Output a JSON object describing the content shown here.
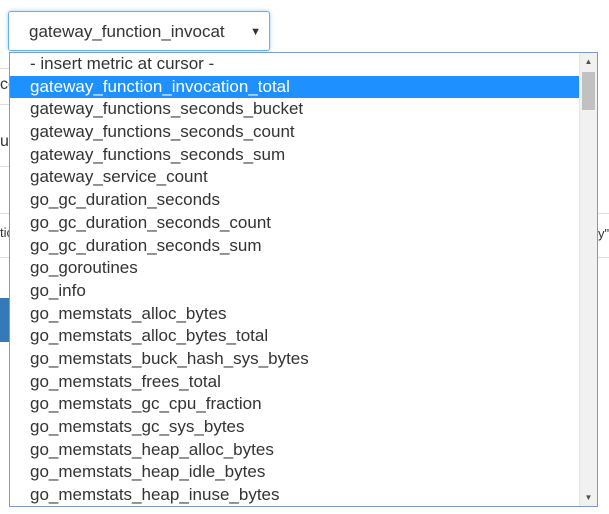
{
  "select": {
    "value": "gateway_function_invocat",
    "caret": "▼"
  },
  "options": [
    "- insert metric at cursor -",
    "gateway_function_invocation_total",
    "gateway_functions_seconds_bucket",
    "gateway_functions_seconds_count",
    "gateway_functions_seconds_sum",
    "gateway_service_count",
    "go_gc_duration_seconds",
    "go_gc_duration_seconds_count",
    "go_gc_duration_seconds_sum",
    "go_goroutines",
    "go_info",
    "go_memstats_alloc_bytes",
    "go_memstats_alloc_bytes_total",
    "go_memstats_buck_hash_sys_bytes",
    "go_memstats_frees_total",
    "go_memstats_gc_cpu_fraction",
    "go_memstats_gc_sys_bytes",
    "go_memstats_heap_alloc_bytes",
    "go_memstats_heap_idle_bytes",
    "go_memstats_heap_inuse_bytes"
  ],
  "selected_index": 1,
  "scrollbar": {
    "up_arrow": "▲",
    "down_arrow": "▼"
  },
  "background": {
    "frag_left_1": "ce",
    "frag_left_2": "u",
    "frag_left_3": "tic",
    "frag_right_1": "y\"]"
  },
  "colors": {
    "selected_bg": "#1e90ff",
    "focus_border": "#66afe9",
    "button_blue": "#337ab7"
  }
}
